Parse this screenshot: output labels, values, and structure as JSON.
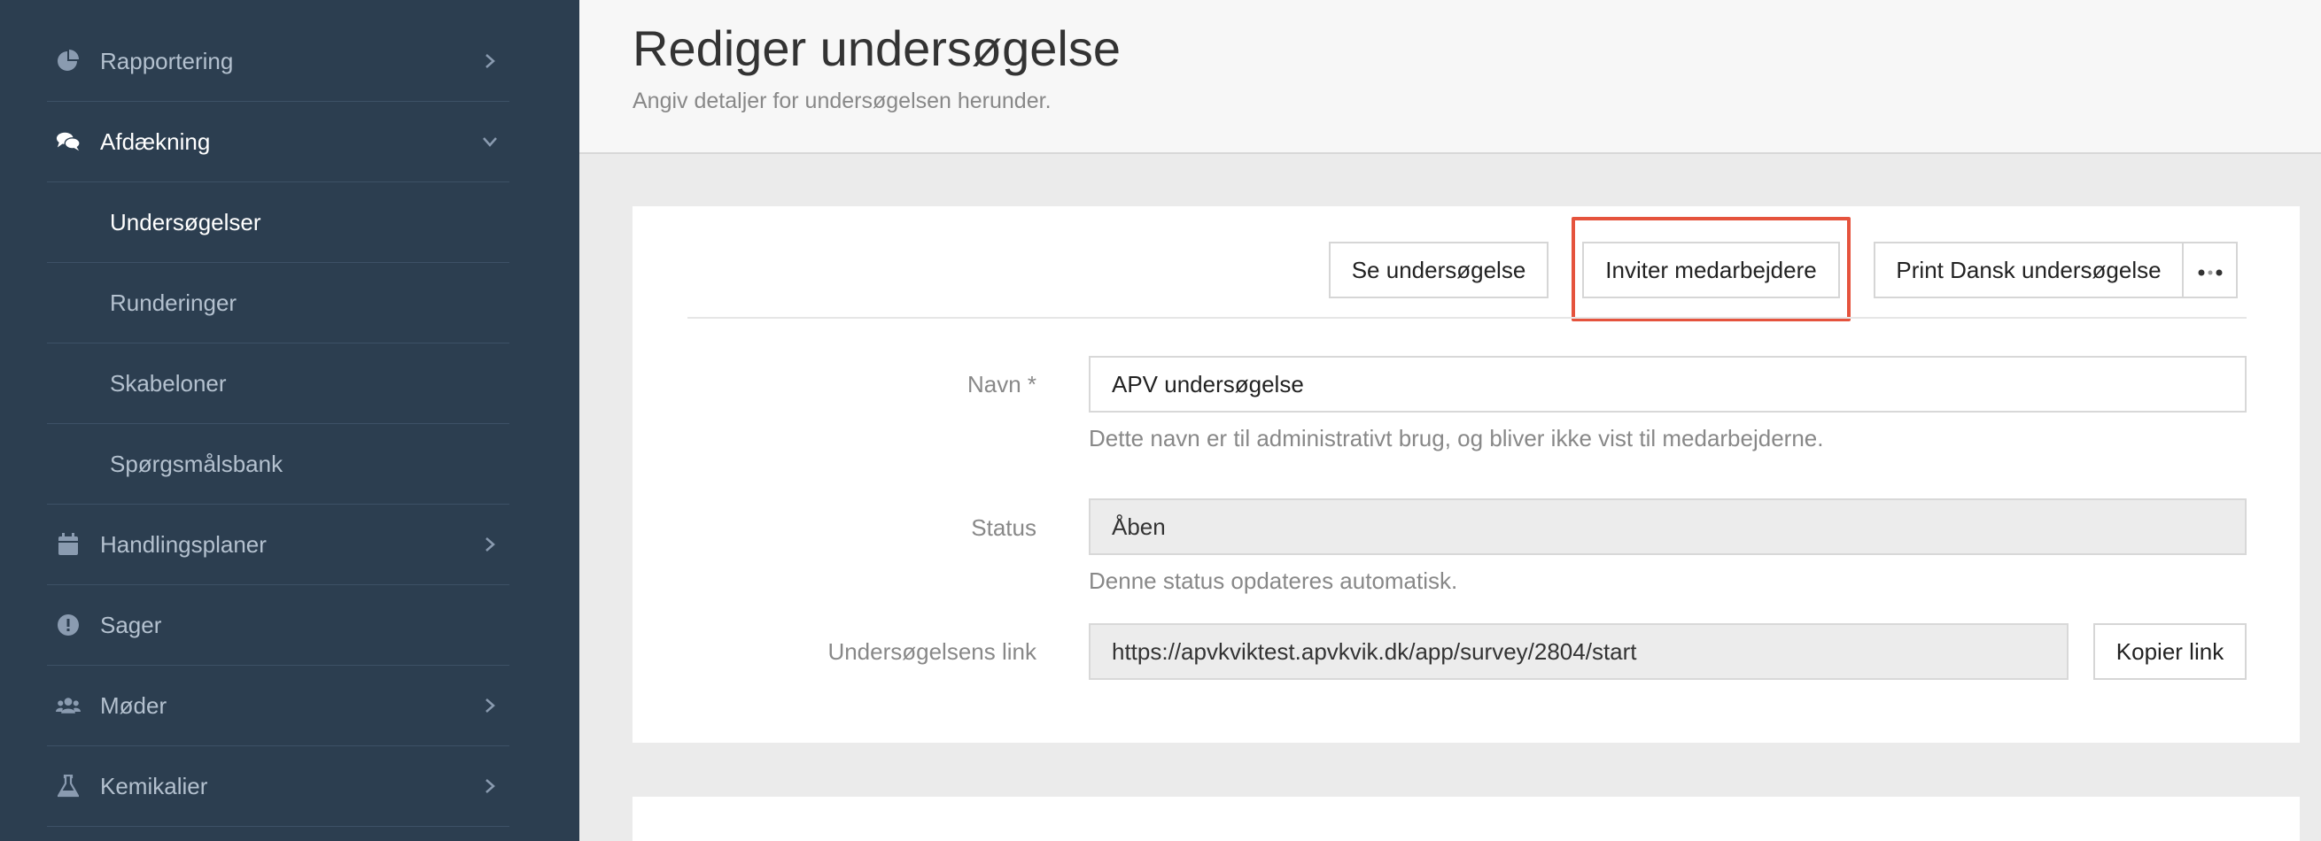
{
  "sidebar": {
    "items": [
      {
        "label": "Rapportering",
        "icon": "pie-chart-icon",
        "has_chevron": "right"
      },
      {
        "label": "Afdækning",
        "icon": "chat-bubbles-icon",
        "has_chevron": "down"
      },
      {
        "label": "Undersøgelser"
      },
      {
        "label": "Runderinger"
      },
      {
        "label": "Skabeloner"
      },
      {
        "label": "Spørgsmålsbank"
      },
      {
        "label": "Handlingsplaner",
        "icon": "calendar-icon",
        "has_chevron": "right"
      },
      {
        "label": "Sager",
        "icon": "alert-icon"
      },
      {
        "label": "Møder",
        "icon": "users-icon",
        "has_chevron": "right"
      },
      {
        "label": "Kemikalier",
        "icon": "flask-icon",
        "has_chevron": "right"
      }
    ]
  },
  "header": {
    "title": "Rediger undersøgelse",
    "subtitle": "Angiv detaljer for undersøgelsen herunder."
  },
  "toolbar": {
    "view_label": "Se undersøgelse",
    "invite_label": "Inviter medarbejdere",
    "print_label": "Print Dansk undersøgelse",
    "more_icon": "more-dots-icon"
  },
  "form": {
    "name_label": "Navn *",
    "name_value": "APV undersøgelse",
    "name_help": "Dette navn er til administrativt brug, og bliver ikke vist til medarbejderne.",
    "status_label": "Status",
    "status_value": "Åben",
    "status_help": "Denne status opdateres automatisk.",
    "link_label": "Undersøgelsens link",
    "link_value": "https://apvkviktest.apvkvik.dk/app/survey/2804/start",
    "copy_label": "Kopier link"
  },
  "colors": {
    "sidebar_bg": "#2c3e50",
    "highlight": "#e5533d"
  }
}
